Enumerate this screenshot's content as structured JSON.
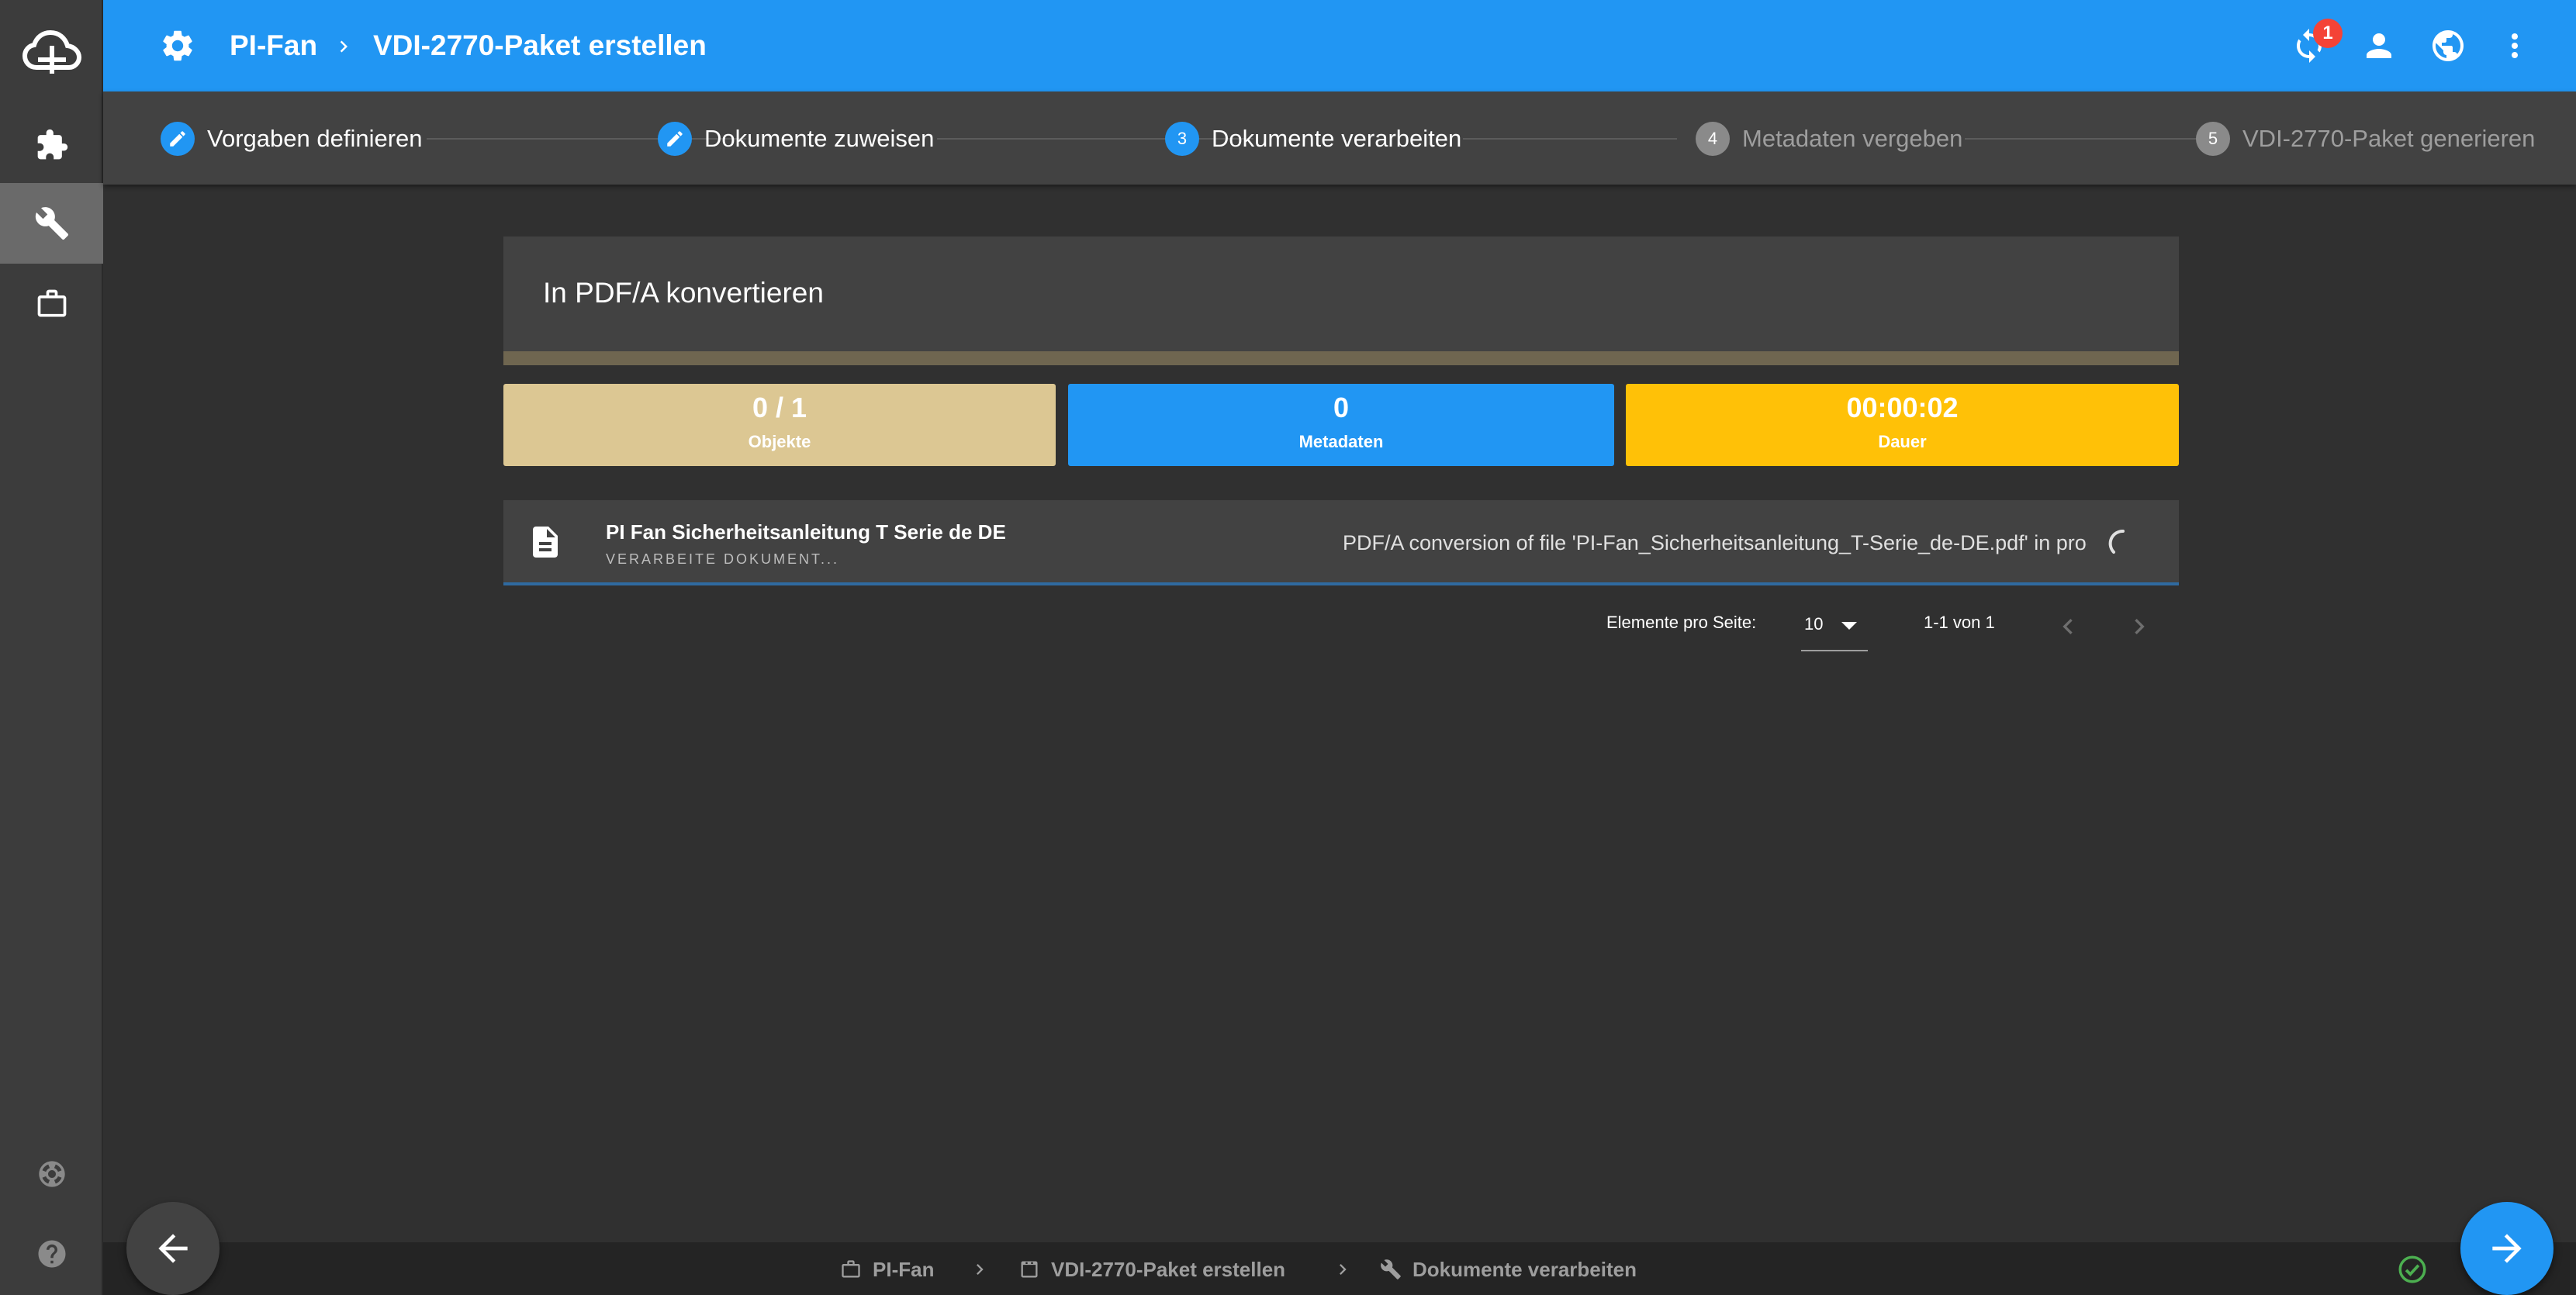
{
  "header": {
    "crumb_project": "PI-Fan",
    "crumb_page": "VDI-2770-Paket erstellen",
    "notification_count": "1"
  },
  "stepper": {
    "steps": [
      {
        "number": "",
        "label": "Vorgaben definieren",
        "state": "done"
      },
      {
        "number": "",
        "label": "Dokumente zuweisen",
        "state": "done"
      },
      {
        "number": "3",
        "label": "Dokumente verarbeiten",
        "state": "current"
      },
      {
        "number": "4",
        "label": "Metadaten vergeben",
        "state": "todo"
      },
      {
        "number": "5",
        "label": "VDI-2770-Paket generieren",
        "state": "todo"
      }
    ]
  },
  "card": {
    "title": "In PDF/A konvertieren"
  },
  "stats": [
    {
      "value": "0 / 1",
      "label": "Objekte",
      "color": "#dcc793"
    },
    {
      "value": "0",
      "label": "Metadaten",
      "color": "#2196f3"
    },
    {
      "value": "00:00:02",
      "label": "Dauer",
      "color": "#ffc107"
    }
  ],
  "document": {
    "name": "PI Fan Sicherheitsanleitung T Serie de DE",
    "status": "VERARBEITE DOKUMENT...",
    "message": "PDF/A conversion of file 'PI-Fan_Sicherheitsanleitung_T-Serie_de-DE.pdf' in progres"
  },
  "pager": {
    "items_label": "Elemente pro Seite:",
    "page_size": "10",
    "range": "1-1 von 1"
  },
  "footer": {
    "crumbs": [
      "PI-Fan",
      "VDI-2770-Paket erstellen",
      "Dokumente verarbeiten"
    ]
  },
  "colors": {
    "primary": "#2196f3",
    "background": "#303030",
    "panel": "#424242",
    "success": "#4caf50"
  }
}
